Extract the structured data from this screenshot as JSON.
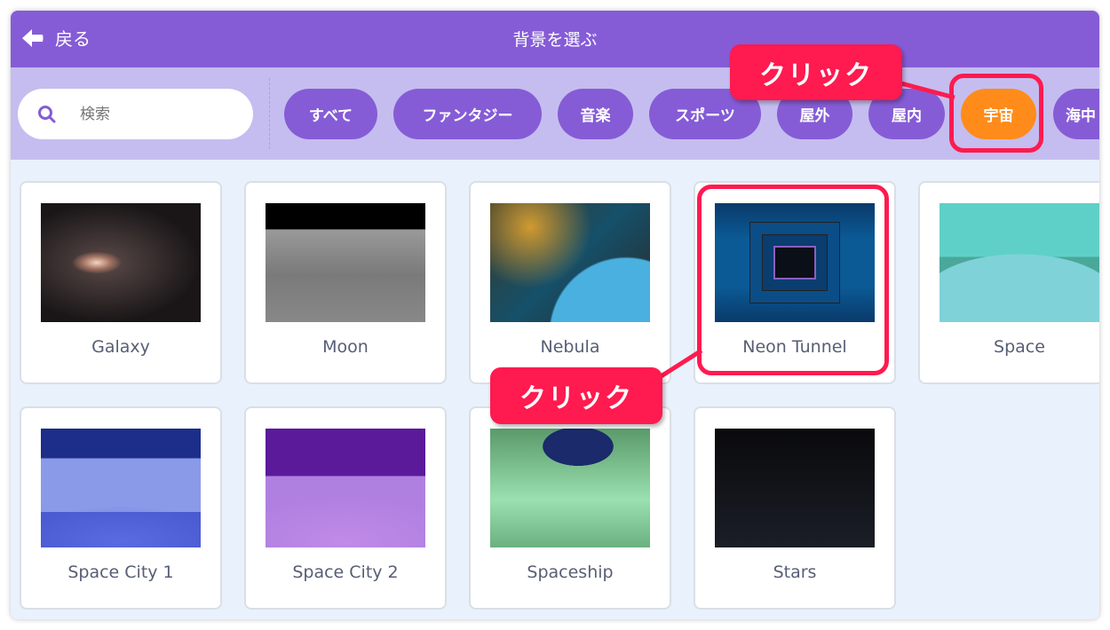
{
  "header": {
    "back_label": "戻る",
    "title": "背景を選ぶ"
  },
  "search": {
    "placeholder": "検索"
  },
  "categories": [
    {
      "label": "すべて",
      "selected": false
    },
    {
      "label": "ファンタジー",
      "selected": false
    },
    {
      "label": "音楽",
      "selected": false
    },
    {
      "label": "スポーツ",
      "selected": false
    },
    {
      "label": "屋外",
      "selected": false
    },
    {
      "label": "屋内",
      "selected": false
    },
    {
      "label": "宇宙",
      "selected": true
    },
    {
      "label": "海中",
      "selected": false
    }
  ],
  "backdrops": [
    {
      "name": "Galaxy"
    },
    {
      "name": "Moon"
    },
    {
      "name": "Nebula"
    },
    {
      "name": "Neon Tunnel"
    },
    {
      "name": "Space"
    },
    {
      "name": "Space City 1"
    },
    {
      "name": "Space City 2"
    },
    {
      "name": "Spaceship"
    },
    {
      "name": "Stars"
    }
  ],
  "annotations": {
    "callout_category": "クリック",
    "callout_backdrop": "クリック"
  },
  "colors": {
    "primary": "#855CD6",
    "selected": "#FF8C1A",
    "annotation": "#FF1A4F"
  }
}
